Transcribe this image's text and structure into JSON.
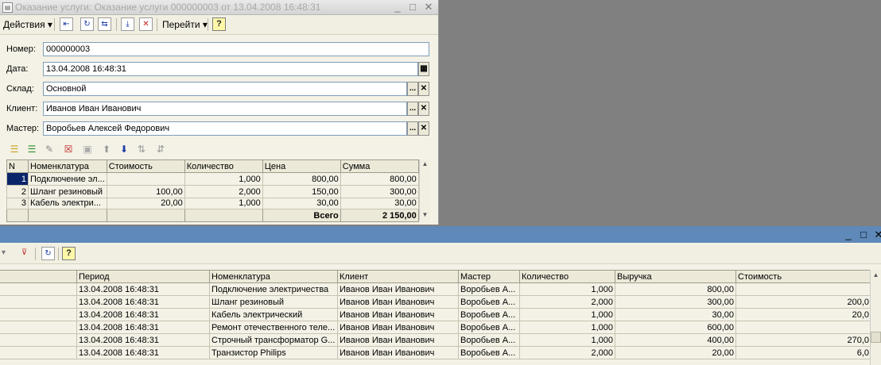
{
  "doc_window": {
    "title": "Оказание услуги: Оказание услуги 000000003 от 13.04.2008 16:48:31",
    "controls": {
      "minimize": "_",
      "maximize": "□",
      "close": "✕"
    },
    "toolbar": {
      "actions_label": "Действия",
      "goto_label": "Перейти",
      "help_label": "?",
      "dropdown_arrow": "▾"
    },
    "fields": {
      "number": {
        "label": "Номер:",
        "value": "000000003"
      },
      "date": {
        "label": "Дата:",
        "value": "13.04.2008 16:48:31"
      },
      "warehouse": {
        "label": "Склад:",
        "value": "Основной"
      },
      "client": {
        "label": "Клиент:",
        "value": "Иванов Иван Иванович"
      },
      "master": {
        "label": "Мастер:",
        "value": "Воробьев Алексей Федорович"
      }
    },
    "field_buttons": {
      "select": "...",
      "clear": "✕"
    },
    "table": {
      "headers": [
        "N",
        "Номенклатура",
        "Стоимость",
        "Количество",
        "Цена",
        "Сумма"
      ],
      "rows": [
        {
          "n": "1",
          "item": "Подключение эл...",
          "cost": "",
          "qty": "1,000",
          "price": "800,00",
          "sum": "800,00"
        },
        {
          "n": "2",
          "item": "Шланг резиновый",
          "cost": "100,00",
          "qty": "2,000",
          "price": "150,00",
          "sum": "300,00"
        },
        {
          "n": "3",
          "item": "Кабель электри...",
          "cost": "20,00",
          "qty": "1,000",
          "price": "30,00",
          "sum": "30,00"
        }
      ],
      "footer": {
        "total_label": "Всего",
        "total_value": "2 150,00"
      }
    }
  },
  "report_window": {
    "controls": {
      "minimize": "_",
      "maximize": "□",
      "close": "✕"
    },
    "toolbar": {
      "help_label": "?"
    },
    "table": {
      "headers": [
        "",
        "Период",
        "Номенклатура",
        "Клиент",
        "Мастер",
        "Количество",
        "Выручка",
        "Стоимость"
      ],
      "rows": [
        {
          "period": "13.04.2008 16:48:31",
          "item": "Подключение электричества",
          "client": "Иванов Иван Иванович",
          "master": "Воробьев А...",
          "qty": "1,000",
          "revenue": "800,00",
          "cost": ""
        },
        {
          "period": "13.04.2008 16:48:31",
          "item": "Шланг резиновый",
          "client": "Иванов Иван Иванович",
          "master": "Воробьев А...",
          "qty": "2,000",
          "revenue": "300,00",
          "cost": "200,0"
        },
        {
          "period": "13.04.2008 16:48:31",
          "item": "Кабель электрический",
          "client": "Иванов Иван Иванович",
          "master": "Воробьев А...",
          "qty": "1,000",
          "revenue": "30,00",
          "cost": "20,0"
        },
        {
          "period": "13.04.2008 16:48:31",
          "item": "Ремонт отечественного теле...",
          "client": "Иванов Иван Иванович",
          "master": "Воробьев А...",
          "qty": "1,000",
          "revenue": "600,00",
          "cost": ""
        },
        {
          "period": "13.04.2008 16:48:31",
          "item": "Строчный трансформатор G...",
          "client": "Иванов Иван Иванович",
          "master": "Воробьев А...",
          "qty": "1,000",
          "revenue": "400,00",
          "cost": "270,0"
        },
        {
          "period": "13.04.2008 16:48:31",
          "item": "Транзистор Philips",
          "client": "Иванов Иван Иванович",
          "master": "Воробьев А...",
          "qty": "2,000",
          "revenue": "20,00",
          "cost": "6,0"
        }
      ]
    }
  },
  "colors": {
    "selection": "#0a246a",
    "report_titlebar": "#5e89b8",
    "desktop": "#808080"
  }
}
